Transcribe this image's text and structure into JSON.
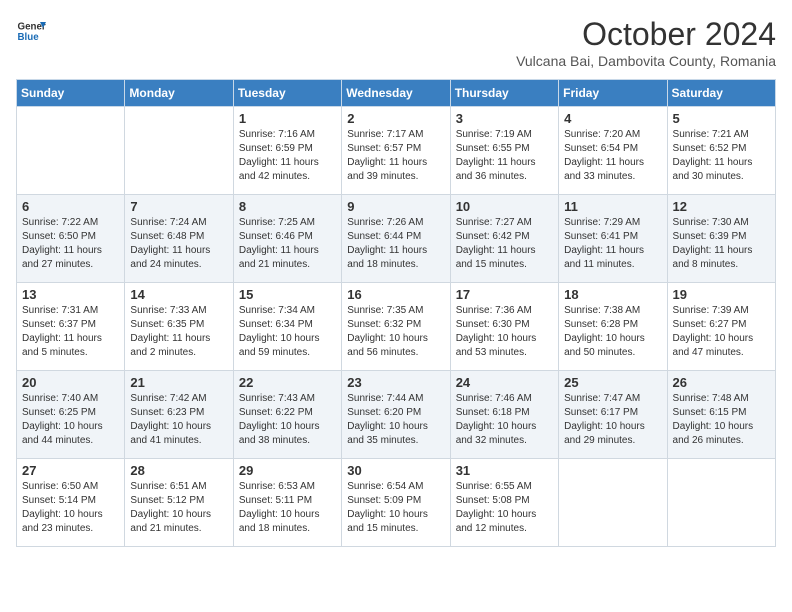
{
  "header": {
    "logo_line1": "General",
    "logo_line2": "Blue",
    "month_title": "October 2024",
    "subtitle": "Vulcana Bai, Dambovita County, Romania"
  },
  "days_of_week": [
    "Sunday",
    "Monday",
    "Tuesday",
    "Wednesday",
    "Thursday",
    "Friday",
    "Saturday"
  ],
  "weeks": [
    [
      {
        "day": "",
        "info": ""
      },
      {
        "day": "",
        "info": ""
      },
      {
        "day": "1",
        "info": "Sunrise: 7:16 AM\nSunset: 6:59 PM\nDaylight: 11 hours and 42 minutes."
      },
      {
        "day": "2",
        "info": "Sunrise: 7:17 AM\nSunset: 6:57 PM\nDaylight: 11 hours and 39 minutes."
      },
      {
        "day": "3",
        "info": "Sunrise: 7:19 AM\nSunset: 6:55 PM\nDaylight: 11 hours and 36 minutes."
      },
      {
        "day": "4",
        "info": "Sunrise: 7:20 AM\nSunset: 6:54 PM\nDaylight: 11 hours and 33 minutes."
      },
      {
        "day": "5",
        "info": "Sunrise: 7:21 AM\nSunset: 6:52 PM\nDaylight: 11 hours and 30 minutes."
      }
    ],
    [
      {
        "day": "6",
        "info": "Sunrise: 7:22 AM\nSunset: 6:50 PM\nDaylight: 11 hours and 27 minutes."
      },
      {
        "day": "7",
        "info": "Sunrise: 7:24 AM\nSunset: 6:48 PM\nDaylight: 11 hours and 24 minutes."
      },
      {
        "day": "8",
        "info": "Sunrise: 7:25 AM\nSunset: 6:46 PM\nDaylight: 11 hours and 21 minutes."
      },
      {
        "day": "9",
        "info": "Sunrise: 7:26 AM\nSunset: 6:44 PM\nDaylight: 11 hours and 18 minutes."
      },
      {
        "day": "10",
        "info": "Sunrise: 7:27 AM\nSunset: 6:42 PM\nDaylight: 11 hours and 15 minutes."
      },
      {
        "day": "11",
        "info": "Sunrise: 7:29 AM\nSunset: 6:41 PM\nDaylight: 11 hours and 11 minutes."
      },
      {
        "day": "12",
        "info": "Sunrise: 7:30 AM\nSunset: 6:39 PM\nDaylight: 11 hours and 8 minutes."
      }
    ],
    [
      {
        "day": "13",
        "info": "Sunrise: 7:31 AM\nSunset: 6:37 PM\nDaylight: 11 hours and 5 minutes."
      },
      {
        "day": "14",
        "info": "Sunrise: 7:33 AM\nSunset: 6:35 PM\nDaylight: 11 hours and 2 minutes."
      },
      {
        "day": "15",
        "info": "Sunrise: 7:34 AM\nSunset: 6:34 PM\nDaylight: 10 hours and 59 minutes."
      },
      {
        "day": "16",
        "info": "Sunrise: 7:35 AM\nSunset: 6:32 PM\nDaylight: 10 hours and 56 minutes."
      },
      {
        "day": "17",
        "info": "Sunrise: 7:36 AM\nSunset: 6:30 PM\nDaylight: 10 hours and 53 minutes."
      },
      {
        "day": "18",
        "info": "Sunrise: 7:38 AM\nSunset: 6:28 PM\nDaylight: 10 hours and 50 minutes."
      },
      {
        "day": "19",
        "info": "Sunrise: 7:39 AM\nSunset: 6:27 PM\nDaylight: 10 hours and 47 minutes."
      }
    ],
    [
      {
        "day": "20",
        "info": "Sunrise: 7:40 AM\nSunset: 6:25 PM\nDaylight: 10 hours and 44 minutes."
      },
      {
        "day": "21",
        "info": "Sunrise: 7:42 AM\nSunset: 6:23 PM\nDaylight: 10 hours and 41 minutes."
      },
      {
        "day": "22",
        "info": "Sunrise: 7:43 AM\nSunset: 6:22 PM\nDaylight: 10 hours and 38 minutes."
      },
      {
        "day": "23",
        "info": "Sunrise: 7:44 AM\nSunset: 6:20 PM\nDaylight: 10 hours and 35 minutes."
      },
      {
        "day": "24",
        "info": "Sunrise: 7:46 AM\nSunset: 6:18 PM\nDaylight: 10 hours and 32 minutes."
      },
      {
        "day": "25",
        "info": "Sunrise: 7:47 AM\nSunset: 6:17 PM\nDaylight: 10 hours and 29 minutes."
      },
      {
        "day": "26",
        "info": "Sunrise: 7:48 AM\nSunset: 6:15 PM\nDaylight: 10 hours and 26 minutes."
      }
    ],
    [
      {
        "day": "27",
        "info": "Sunrise: 6:50 AM\nSunset: 5:14 PM\nDaylight: 10 hours and 23 minutes."
      },
      {
        "day": "28",
        "info": "Sunrise: 6:51 AM\nSunset: 5:12 PM\nDaylight: 10 hours and 21 minutes."
      },
      {
        "day": "29",
        "info": "Sunrise: 6:53 AM\nSunset: 5:11 PM\nDaylight: 10 hours and 18 minutes."
      },
      {
        "day": "30",
        "info": "Sunrise: 6:54 AM\nSunset: 5:09 PM\nDaylight: 10 hours and 15 minutes."
      },
      {
        "day": "31",
        "info": "Sunrise: 6:55 AM\nSunset: 5:08 PM\nDaylight: 10 hours and 12 minutes."
      },
      {
        "day": "",
        "info": ""
      },
      {
        "day": "",
        "info": ""
      }
    ]
  ]
}
